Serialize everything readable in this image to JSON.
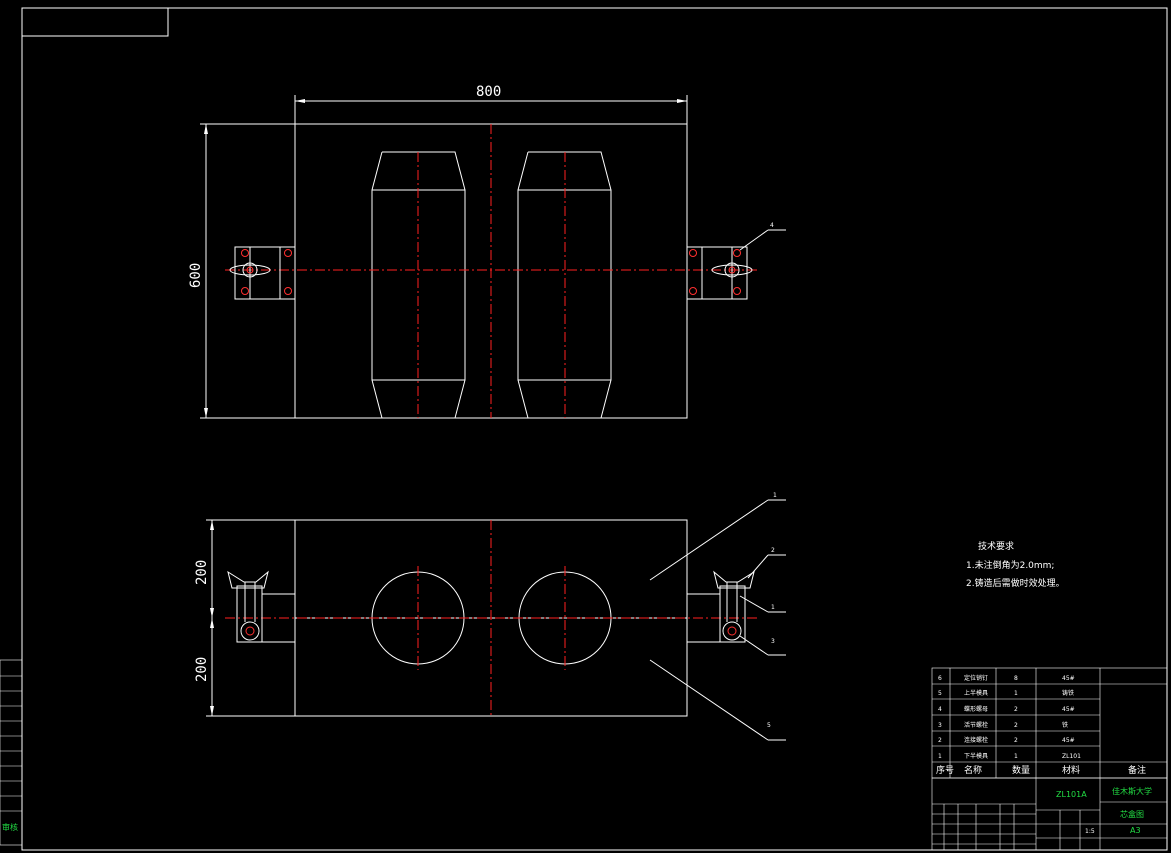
{
  "drawing": {
    "dimensions": {
      "top_width": "800",
      "top_height": "600",
      "front_upper": "200",
      "front_lower": "200"
    },
    "leader_labels": {
      "top_view": "4",
      "front_1": "1",
      "front_2": "2",
      "front_3": "1",
      "front_4": "3",
      "front_5": "5"
    },
    "technical_requirements": {
      "title": "技术要求",
      "line1": "1.未注倒角为2.0mm;",
      "line2": "2.铸造后需做时效处理。"
    }
  },
  "parts_list": {
    "rows": [
      {
        "no": "6",
        "name": "定位销钉",
        "qty": "8",
        "material": "45#"
      },
      {
        "no": "5",
        "name": "上半模具",
        "qty": "1",
        "material": "铸铁"
      },
      {
        "no": "4",
        "name": "蝶形螺母",
        "qty": "2",
        "material": "45#"
      },
      {
        "no": "3",
        "name": "活节螺栓",
        "qty": "2",
        "material": "铁"
      },
      {
        "no": "2",
        "name": "连接螺栓",
        "qty": "2",
        "material": "45#"
      },
      {
        "no": "1",
        "name": "下半模具",
        "qty": "1",
        "material": "ZL101"
      }
    ],
    "header": {
      "no": "序号",
      "name": "名称",
      "qty": "数量",
      "material": "材料",
      "note": "备注"
    }
  },
  "title_block": {
    "material_code": "ZL101A",
    "school": "佳木斯大学",
    "drawing_name": "芯盒图",
    "sheet_size": "A3",
    "scale": "1:5"
  },
  "left_strip": {
    "label": "审核"
  }
}
